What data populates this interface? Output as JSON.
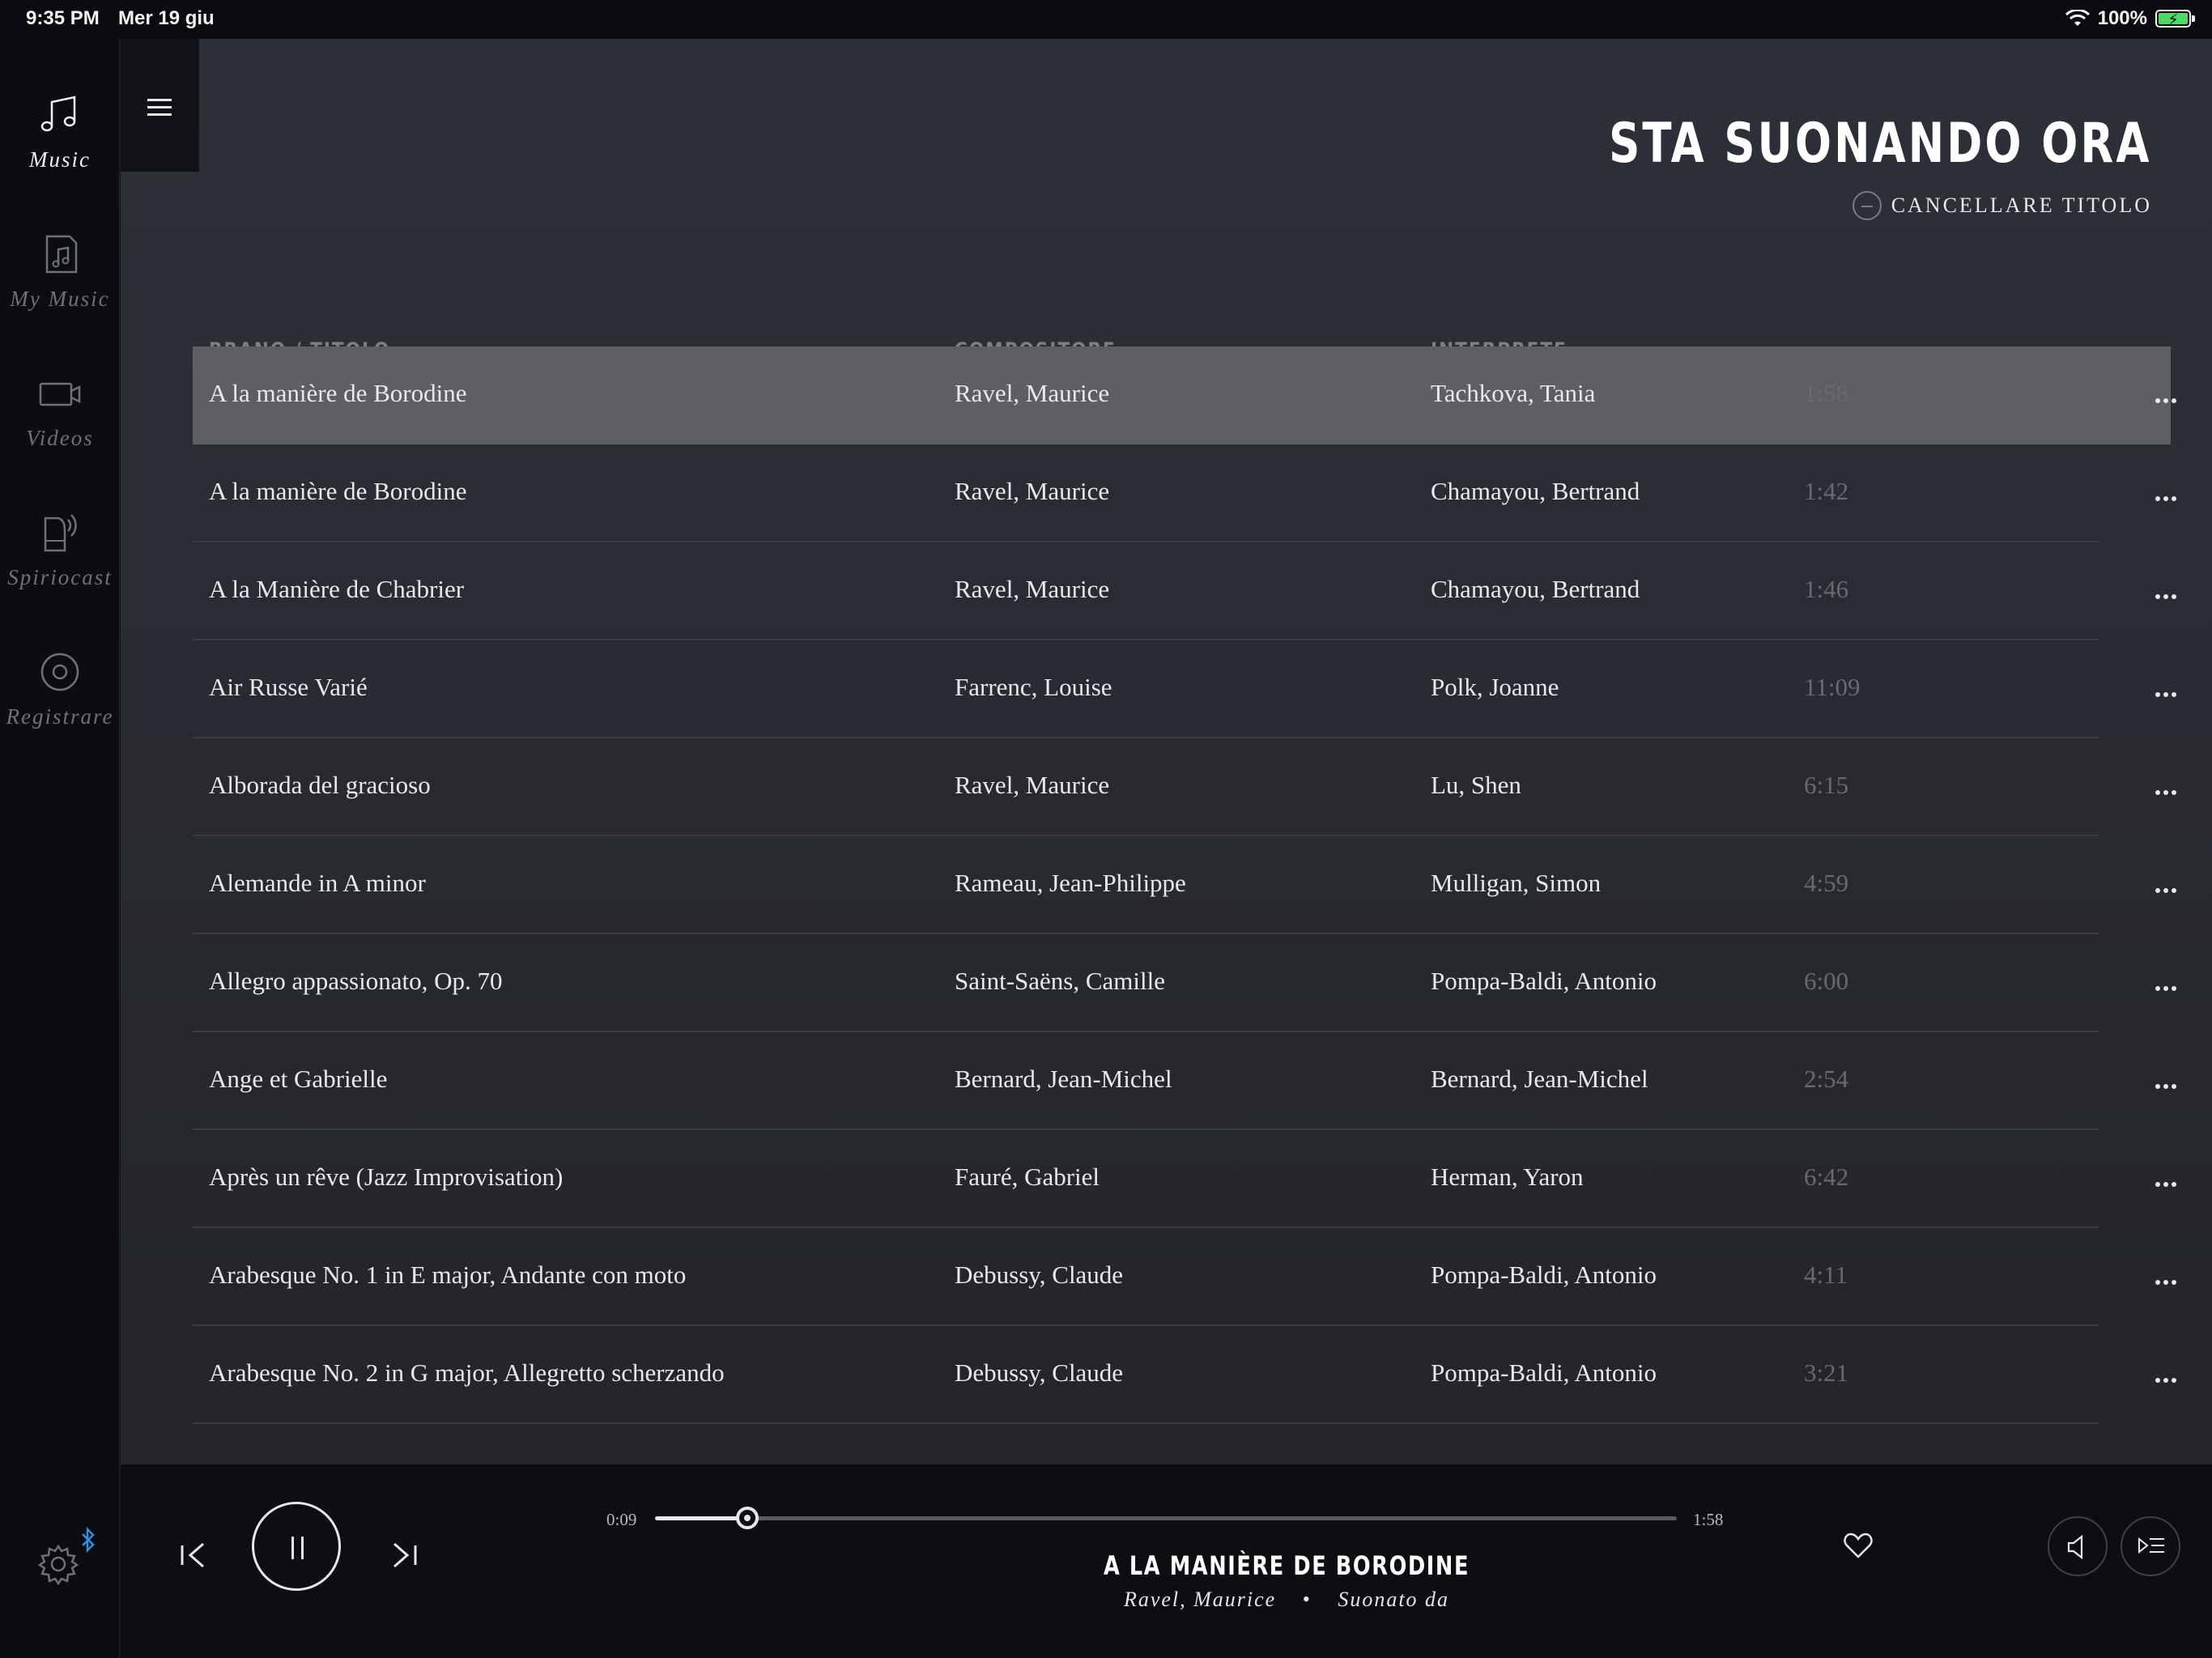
{
  "status": {
    "time": "9:35 PM",
    "date": "Mer 19 giu",
    "battery": "100%",
    "wifi_icon": "wifi-icon",
    "battery_icon": "battery-charging-icon"
  },
  "sidebar": {
    "items": [
      {
        "label": "Music",
        "icon": "music-note-icon",
        "active": true
      },
      {
        "label": "My Music",
        "icon": "music-folder-icon",
        "active": false
      },
      {
        "label": "Videos",
        "icon": "video-camera-icon",
        "active": false
      },
      {
        "label": "Spiriocast",
        "icon": "piano-broadcast-icon",
        "active": false
      },
      {
        "label": "Registrare",
        "icon": "record-icon",
        "active": false
      }
    ],
    "settings_icon": "gear-icon",
    "bluetooth_icon": "bluetooth-icon"
  },
  "header": {
    "title": "STA SUONANDO ORA",
    "clear_label": "CANCELLARE TITOLO"
  },
  "table": {
    "columns": [
      "BRANO / TITOLO",
      "COMPOSITORE",
      "INTERPRETE"
    ],
    "rows": [
      {
        "title": "A la manière de Borodine",
        "composer": "Ravel, Maurice",
        "performer": "Tachkova, Tania",
        "duration": "1:58",
        "active": true
      },
      {
        "title": "A la manière de Borodine",
        "composer": "Ravel, Maurice",
        "performer": "Chamayou, Bertrand",
        "duration": "1:42"
      },
      {
        "title": "A la Manière de Chabrier",
        "composer": "Ravel, Maurice",
        "performer": "Chamayou, Bertrand",
        "duration": "1:46"
      },
      {
        "title": "Air Russe Varié",
        "composer": "Farrenc, Louise",
        "performer": "Polk, Joanne",
        "duration": "11:09"
      },
      {
        "title": "Alborada del gracioso",
        "composer": "Ravel, Maurice",
        "performer": "Lu, Shen",
        "duration": "6:15"
      },
      {
        "title": "Alemande in A minor",
        "composer": "Rameau, Jean-Philippe",
        "performer": "Mulligan, Simon",
        "duration": "4:59"
      },
      {
        "title": "Allegro appassionato, Op. 70",
        "composer": "Saint-Saëns, Camille",
        "performer": "Pompa-Baldi, Antonio",
        "duration": "6:00"
      },
      {
        "title": "Ange et Gabrielle",
        "composer": "Bernard, Jean-Michel",
        "performer": "Bernard, Jean-Michel",
        "duration": "2:54"
      },
      {
        "title": "Après un rêve (Jazz Improvisation)",
        "composer": "Fauré, Gabriel",
        "performer": "Herman, Yaron",
        "duration": "6:42"
      },
      {
        "title": "Arabesque No. 1 in E major, Andante con moto",
        "composer": "Debussy, Claude",
        "performer": "Pompa-Baldi, Antonio",
        "duration": "4:11"
      },
      {
        "title": "Arabesque No. 2 in G major, Allegretto scherzando",
        "composer": "Debussy, Claude",
        "performer": "Pompa-Baldi, Antonio",
        "duration": "3:21"
      }
    ]
  },
  "player": {
    "elapsed": "0:09",
    "total": "1:58",
    "progress_fraction": 0.09,
    "now_playing_title": "A LA MANIÈRE DE BORODINE",
    "now_playing_composer": "Ravel, Maurice",
    "now_playing_separator": "•",
    "now_playing_performed_by": "Suonato da"
  }
}
